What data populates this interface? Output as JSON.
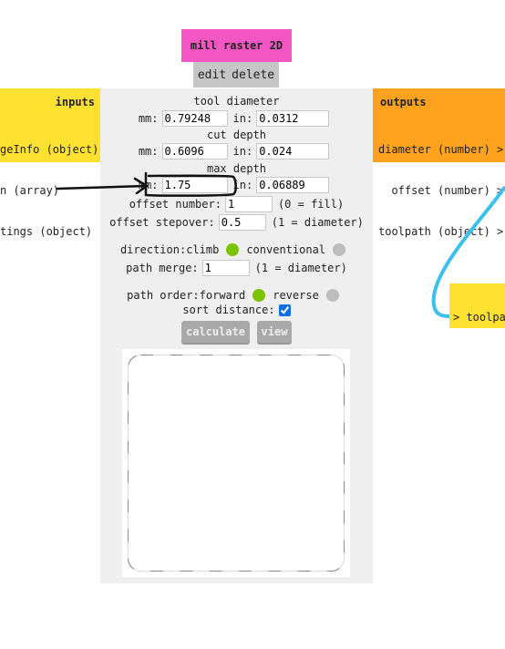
{
  "module": {
    "title": "mill raster 2D",
    "edit_label": "edit",
    "delete_label": "delete",
    "title_color": "#f456c4"
  },
  "inputs": {
    "header": "inputs",
    "items": [
      "geInfo (object)",
      "n (array)",
      "tings (object)"
    ]
  },
  "outputs": {
    "header": "outputs",
    "items": [
      "diameter (number) >",
      "offset (number) >",
      "toolpath (object) >"
    ]
  },
  "controls": {
    "tool_diameter": {
      "label": "tool diameter",
      "mm_label": "mm:",
      "mm": "0.79248",
      "in_label": "in:",
      "in": "0.0312"
    },
    "cut_depth": {
      "label": "cut depth",
      "mm_label": "mm:",
      "mm": "0.6096",
      "in_label": "in:",
      "in": "0.024"
    },
    "max_depth": {
      "label": "max depth",
      "mm_label": "mm:",
      "mm": "1.75",
      "in_label": "in:",
      "in": "0.06889"
    },
    "offset_number": {
      "label": "offset number:",
      "value": "1",
      "hint": "(0 = fill)"
    },
    "offset_stepover": {
      "label": "offset stepover:",
      "value": "0.5",
      "hint": "(1 = diameter)"
    },
    "direction": {
      "label": "direction:",
      "option1": "climb",
      "option2": "conventional",
      "selected": "climb"
    },
    "path_merge": {
      "label": "path merge:",
      "value": "1",
      "hint": "(1 = diameter)"
    },
    "path_order": {
      "label": "path order:",
      "option1": "forward",
      "option2": "reverse",
      "selected": "forward"
    },
    "sort_distance": {
      "label": "sort distance:",
      "checked": true
    },
    "calculate_label": "calculate",
    "view_label": "view"
  },
  "connected_node": {
    "port_label": "> toolpa"
  },
  "colors": {
    "selected": "#7dc400",
    "unselected": "#bdbdbd",
    "wire": "#3bbfef",
    "inputs_bg": "#ffe132",
    "outputs_bg": "#ffa31f"
  }
}
